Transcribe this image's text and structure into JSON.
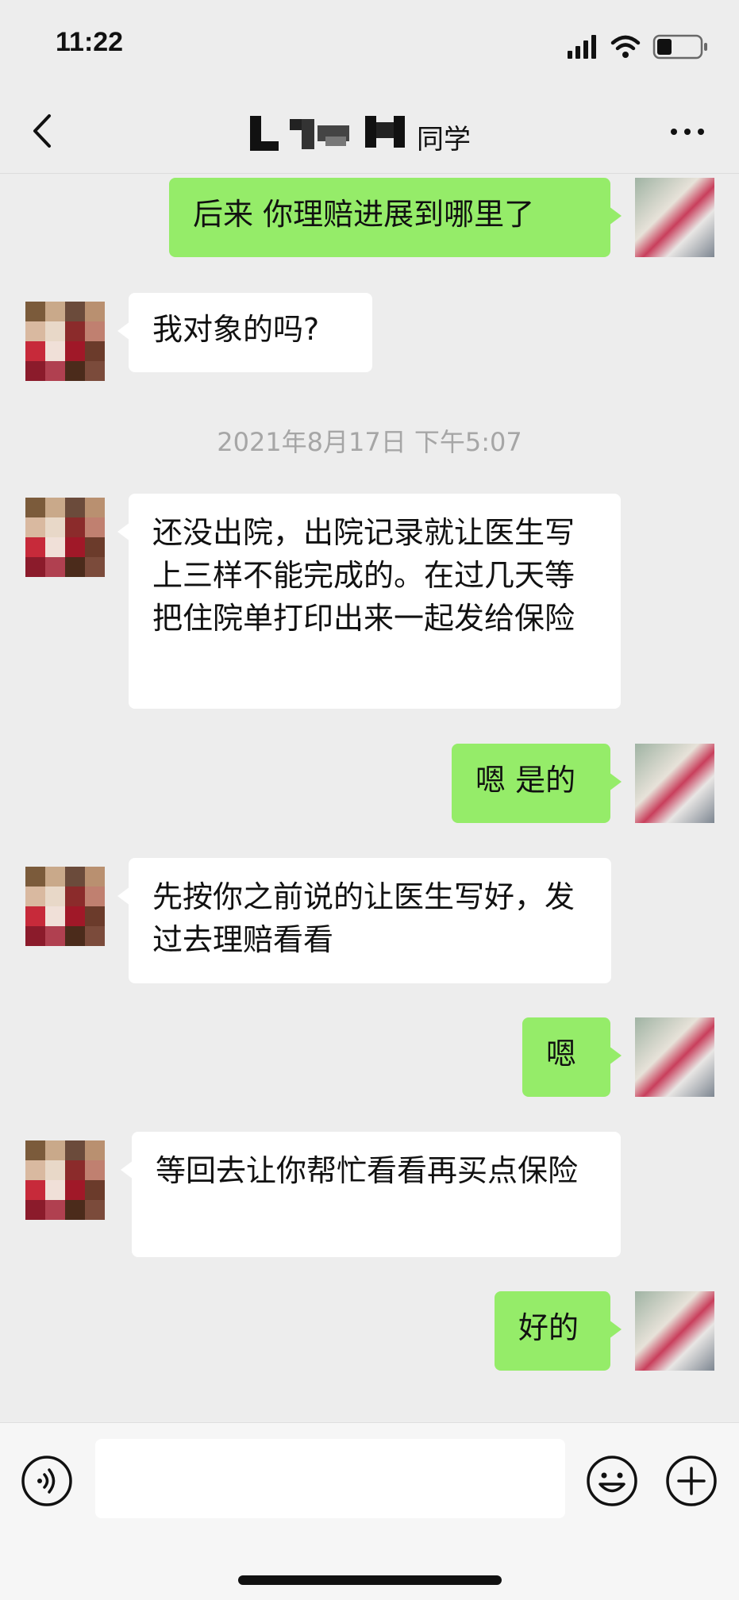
{
  "status_bar": {
    "time": "11:22"
  },
  "nav": {
    "title": "同学",
    "back_icon": "chevron-left-icon",
    "more_icon": "more-dots-icon"
  },
  "messages": [
    {
      "sender": "me",
      "text": "后来 你理赔进展到哪里了"
    },
    {
      "sender": "other",
      "text": "我对象的吗?"
    },
    {
      "type": "timestamp",
      "text": "2021年8月17日 下午5:07"
    },
    {
      "sender": "other",
      "text": "还没出院，出院记录就让医生写上三样不能完成的。在过几天等把住院单打印出来一起发给保险"
    },
    {
      "sender": "me",
      "text": "嗯 是的"
    },
    {
      "sender": "other",
      "text": "先按你之前说的让医生写好，发过去理赔看看"
    },
    {
      "sender": "me",
      "text": "嗯"
    },
    {
      "sender": "other",
      "text": "等回去让你帮忙看看再买点保险"
    },
    {
      "sender": "me",
      "text": "好的"
    }
  ],
  "input_bar": {
    "voice_icon": "voice-icon",
    "emoji_icon": "emoji-icon",
    "plus_icon": "plus-icon",
    "input_value": ""
  },
  "colors": {
    "my_bubble": "#95ec69",
    "other_bubble": "#ffffff",
    "background": "#ededed",
    "timestamp": "#a6a6a6"
  }
}
